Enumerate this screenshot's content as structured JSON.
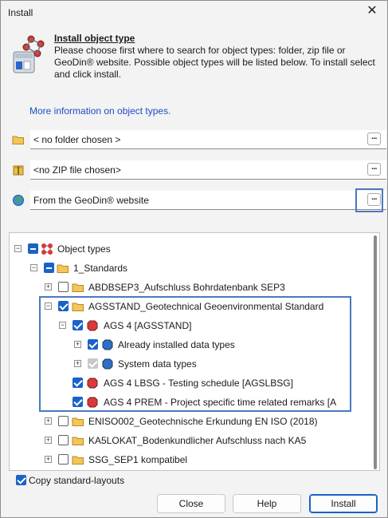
{
  "window": {
    "title": "Install",
    "close_glyph": "✕"
  },
  "header": {
    "title": "Install object type",
    "description": "Please choose first where to search for object types: folder, zip file or GeoDin® website. Possible object types will be listed below. To install select and click install."
  },
  "more_info_link": "More information on object types.",
  "sources": {
    "folder": {
      "value": "< no folder chosen >",
      "icon": "folder-icon",
      "button": "..."
    },
    "zip": {
      "value": "<no ZIP file chosen>",
      "icon": "zip-archive-icon",
      "button": "..."
    },
    "website": {
      "value": "From the GeoDin® website",
      "icon": "globe-icon",
      "button": "..."
    }
  },
  "tree": {
    "root": {
      "label": "Object types",
      "expander": "−",
      "check": "partial",
      "icon": "object-types-icon"
    },
    "standards": {
      "label": "1_Standards",
      "expander": "−",
      "check": "partial",
      "icon": "folder-icon"
    },
    "abdbsep3": {
      "label": "ABDBSEP3_Aufschluss Bohrdatenbank SEP3",
      "expander": "+",
      "check": "none",
      "icon": "folder-icon"
    },
    "agsstand": {
      "label": "AGSSTAND_Geotechnical Geoenvironmental Standard",
      "expander": "−",
      "check": "checked",
      "icon": "folder-icon"
    },
    "ags4": {
      "label": "AGS 4 [AGSSTAND]",
      "expander": "−",
      "check": "checked",
      "icon": "object-type-red-icon"
    },
    "installed": {
      "label": "Already installed data types",
      "expander": "+",
      "check": "checked",
      "icon": "data-type-blue-icon"
    },
    "system": {
      "label": "System data types",
      "expander": "+",
      "check": "disabled",
      "icon": "data-type-blue-icon"
    },
    "lbsg": {
      "label": "AGS 4 LBSG - Testing schedule [AGSLBSG]",
      "check": "checked",
      "icon": "object-type-red-icon"
    },
    "prem": {
      "label": "AGS 4 PREM - Project specific time related remarks [A",
      "check": "checked",
      "icon": "object-type-red-icon"
    },
    "eniso": {
      "label": "ENISO002_Geotechnische Erkundung EN ISO (2018)",
      "expander": "+",
      "check": "none",
      "icon": "folder-icon"
    },
    "kaslokat": {
      "label": "KA5LOKAT_Bodenkundlicher Aufschluss nach KA5",
      "expander": "+",
      "check": "none",
      "icon": "folder-icon"
    },
    "ssgsep1": {
      "label": "SSG_SEP1 kompatibel",
      "expander": "+",
      "check": "none",
      "icon": "folder-icon"
    }
  },
  "copy_layouts": {
    "label": "Copy standard-layouts",
    "checked": true
  },
  "buttons": {
    "close": "Close",
    "help": "Help",
    "install": "Install"
  },
  "colors": {
    "accent": "#1863c8",
    "link": "#1a4fc4",
    "highlight": "#4a78c0"
  }
}
